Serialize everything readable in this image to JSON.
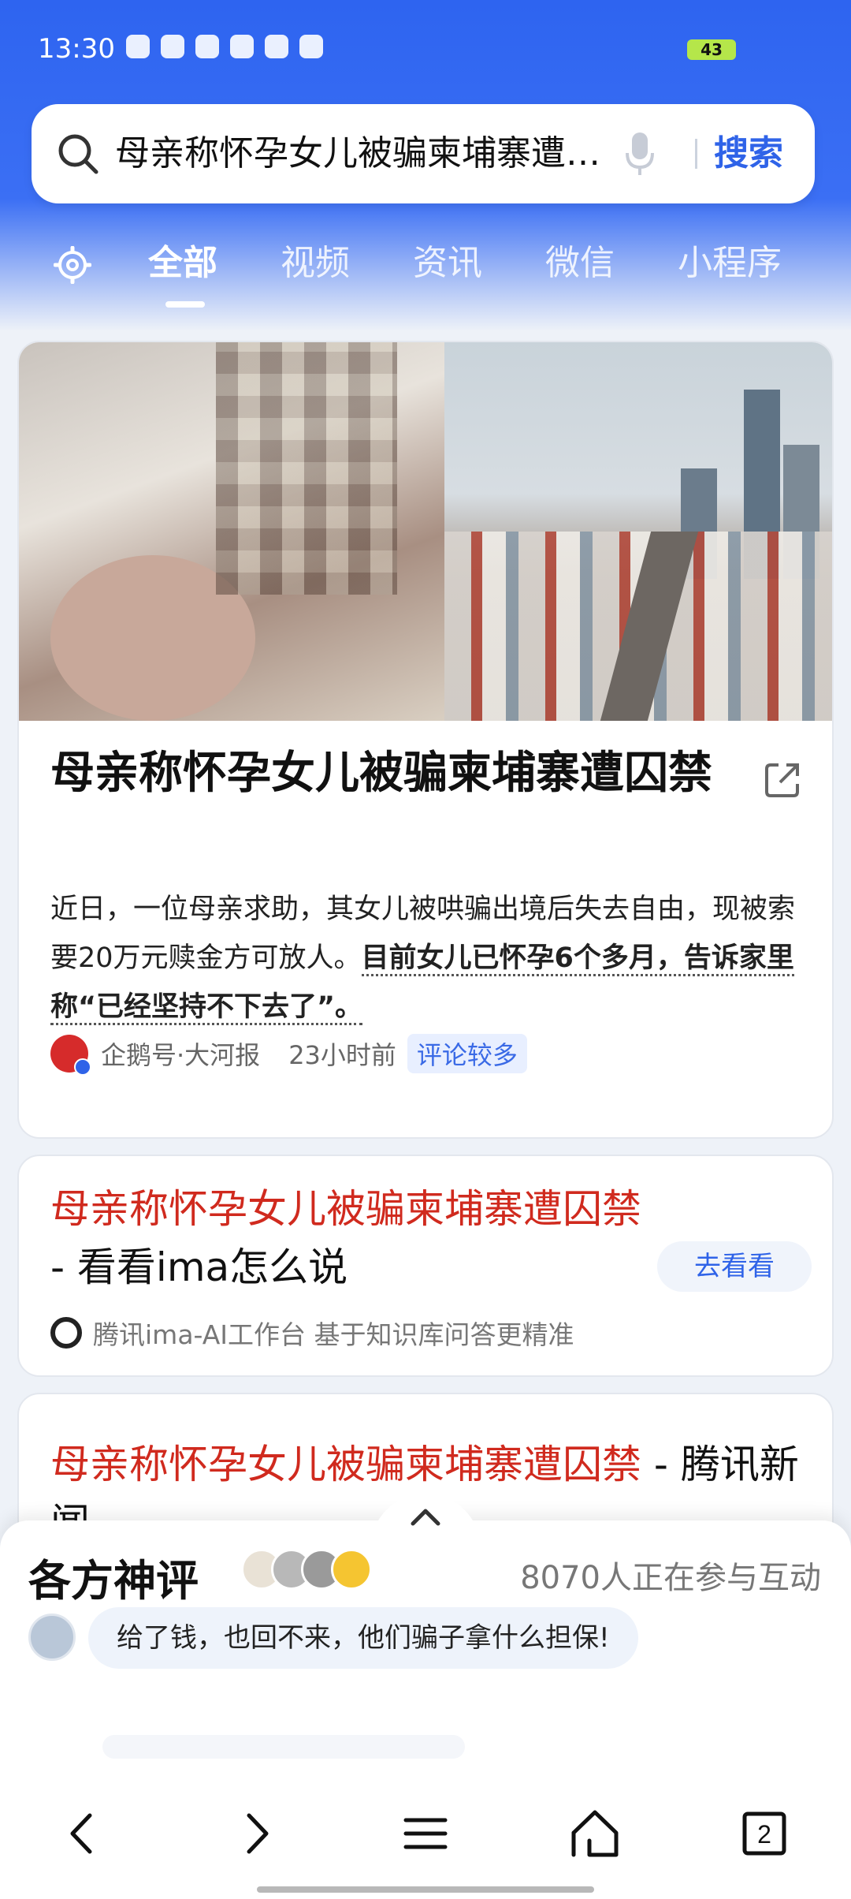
{
  "status_bar": {
    "time": "13:30",
    "battery": "43"
  },
  "search": {
    "query": "母亲称怀孕女儿被骗柬埔寨遭囚禁",
    "button": "搜索"
  },
  "tabs": [
    {
      "label": "全部",
      "active": true
    },
    {
      "label": "视频",
      "active": false
    },
    {
      "label": "资讯",
      "active": false
    },
    {
      "label": "微信",
      "active": false
    },
    {
      "label": "小程序",
      "active": false
    }
  ],
  "result1": {
    "title": "母亲称怀孕女儿被骗柬埔寨遭囚禁",
    "summary_plain": "近日，一位母亲求助，其女儿被哄骗出境后失去自由，现被索要20万元赎金方可放人。",
    "summary_highlight": "目前女儿已怀孕6个多月，告诉家里称“已经坚持不下去了”。",
    "source": "企鹅号·大河报",
    "time": "23小时前",
    "badge": "评论较多"
  },
  "result2": {
    "title_red": "母亲称怀孕女儿被骗柬埔寨遭囚禁",
    "title_rest": " - 看看ima怎么说",
    "action": "去看看",
    "source": "腾讯ima-AI工作台 基于知识库问答更精准"
  },
  "result3": {
    "title_red": "母亲称怀孕女儿被骗柬埔寨遭囚禁",
    "title_rest": " - 腾讯新闻"
  },
  "panel": {
    "title": "各方神评",
    "count": "8070人正在参与互动",
    "comment": "给了钱，也回不来，他们骗子拿什么担保!"
  },
  "nav": {
    "tabs_count": "2"
  },
  "colors": {
    "accent": "#2f63e8",
    "header_blue": "#3b6ff4",
    "highlight_red": "#d02a1e"
  },
  "icons": [
    "search-icon",
    "mic-icon",
    "gear-icon",
    "share-icon",
    "chevron-up-icon",
    "back-icon",
    "forward-icon",
    "menu-icon",
    "home-icon",
    "tabs-icon"
  ]
}
